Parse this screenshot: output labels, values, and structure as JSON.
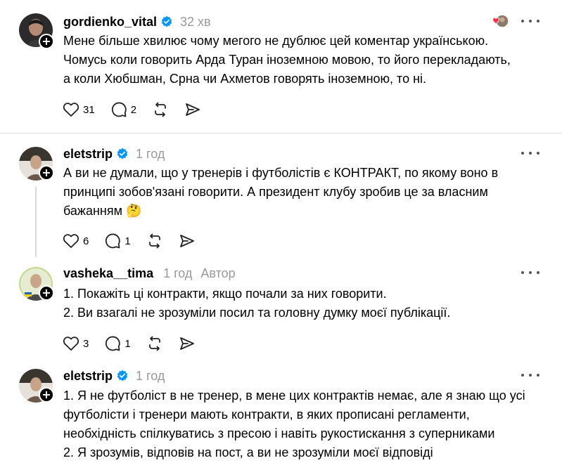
{
  "posts": [
    {
      "username": "gordienko_vital",
      "time": "32 хв",
      "lines": [
        "Мене більше хвилює чому мегого не дублює цей коментар українською.",
        "Чомусь коли говорить Арда Туран іноземною мовою, то його перекладають,",
        "а коли Хюбшман, Срна чи Ахметов говорять іноземною, то ні."
      ],
      "likes": "31",
      "replies": "2"
    },
    {
      "username": "eletstrip",
      "time": "1 год",
      "lines": [
        "А ви не думали, що у тренерів і футболістів є КОНТРАКТ, по якому воно в",
        "принципі зобов'язані говорити. А президент клубу зробив це за власним",
        "бажанням"
      ],
      "emoji": "🤔",
      "likes": "6",
      "replies": "1"
    },
    {
      "username": "vasheka__tima",
      "time": "1 год",
      "author_label": "Автор",
      "lines": [
        "1. Покажіть ці контракти, якщо почали за них говорити.",
        "2. Ви взагалі не зрозуміли посил та головну думку моєї публікації."
      ],
      "likes": "3",
      "replies": "1"
    },
    {
      "username": "eletstrip",
      "time": "1 год",
      "lines": [
        "1. Я не футболіст в не тренер, в мене цих контрактів немає, але я знаю що усі",
        "футболісти і тренери мають контракти, в яких прописані регламенти,",
        "необхідність спілкуватись з пресою і навіть рукостискання з суперниками",
        "2. Я зрозумів, відповів на пост, а ви не зрозуміли моєї відповіді"
      ]
    }
  ],
  "colors": {
    "verified": "#0095f6",
    "muted": "#999999",
    "like_heart": "#ff3040"
  },
  "icons": {
    "like": "heart-icon",
    "reply": "comment-icon",
    "repost": "repost-icon",
    "share": "send-icon",
    "more": "more-icon",
    "verified": "verified-badge-icon",
    "follow": "plus-icon"
  }
}
